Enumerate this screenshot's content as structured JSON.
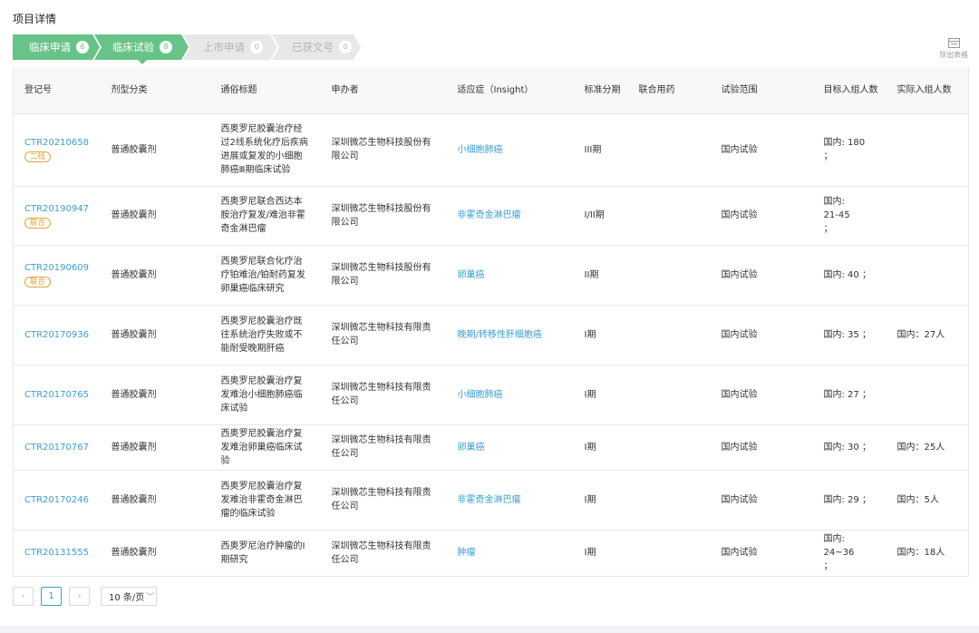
{
  "page": {
    "title": "项目详情"
  },
  "steps": [
    {
      "label": "临床申请",
      "count": "6"
    },
    {
      "label": "临床试验",
      "count": "8"
    },
    {
      "label": "上市申请",
      "count": "0"
    },
    {
      "label": "已获文号",
      "count": "0"
    }
  ],
  "toolbar": {
    "export_label": "导出表格"
  },
  "table": {
    "headers": {
      "reg_no": "登记号",
      "dosage_form": "剂型分类",
      "title": "通俗标题",
      "sponsor": "申办者",
      "indication": "适应症（Insight）",
      "phase": "标准分期",
      "combo": "联合用药",
      "scope": "试验范围",
      "target": "目标入组人数",
      "actual": "实际入组人数"
    },
    "rows": [
      {
        "reg_no": "CTR20210658",
        "tag": "二线",
        "dosage_form": "普通胶囊剂",
        "title": "西奥罗尼胶囊治疗经过2线系统化疗后疾病进展或复发的小细胞肺癌Ⅲ期临床试验",
        "sponsor": "深圳微芯生物科技股份有限公司",
        "indication": "小细胞肺癌",
        "phase": "III期",
        "combo": "",
        "scope": "国内试验",
        "target": "国内: 180 ；",
        "actual": ""
      },
      {
        "reg_no": "CTR20190947",
        "tag": "联合",
        "dosage_form": "普通胶囊剂",
        "title": "西奥罗尼联合西达本胺治疗复发/难治非霍奇金淋巴瘤",
        "sponsor": "深圳微芯生物科技股份有限公司",
        "indication": "非霍奇金淋巴瘤",
        "phase": "I/II期",
        "combo": "",
        "scope": "国内试验",
        "target": "国内: 21-45 ；",
        "actual": ""
      },
      {
        "reg_no": "CTR20190609",
        "tag": "联合",
        "dosage_form": "普通胶囊剂",
        "title": "西奥罗尼联合化疗治疗铂难治/铂耐药复发卵巢癌临床研究",
        "sponsor": "深圳微芯生物科技股份有限公司",
        "indication": "卵巢癌",
        "phase": "II期",
        "combo": "",
        "scope": "国内试验",
        "target": "国内: 40 ；",
        "actual": ""
      },
      {
        "reg_no": "CTR20170936",
        "tag": "",
        "dosage_form": "普通胶囊剂",
        "title": "西奥罗尼胶囊治疗既往系统治疗失败或不能耐受晚期肝癌",
        "sponsor": "深圳微芯生物科技有限责任公司",
        "indication": "晚期/转移性肝细胞癌",
        "phase": "I期",
        "combo": "",
        "scope": "国内试验",
        "target": "国内: 35 ；",
        "actual": "国内：27人"
      },
      {
        "reg_no": "CTR20170765",
        "tag": "",
        "dosage_form": "普通胶囊剂",
        "title": "西奥罗尼胶囊治疗复发难治小细胞肺癌临床试验",
        "sponsor": "深圳微芯生物科技有限责任公司",
        "indication": "小细胞肺癌",
        "phase": "I期",
        "combo": "",
        "scope": "国内试验",
        "target": "国内: 27 ；",
        "actual": ""
      },
      {
        "reg_no": "CTR20170767",
        "tag": "",
        "dosage_form": "普通胶囊剂",
        "title": "西奥罗尼胶囊治疗复发难治卵巢癌临床试验",
        "sponsor": "深圳微芯生物科技有限责任公司",
        "indication": "卵巢癌",
        "phase": "I期",
        "combo": "",
        "scope": "国内试验",
        "target": "国内: 30 ；",
        "actual": "国内：25人"
      },
      {
        "reg_no": "CTR20170246",
        "tag": "",
        "dosage_form": "普通胶囊剂",
        "title": "西奥罗尼胶囊治疗复发难治非霍奇金淋巴瘤的临床试验",
        "sponsor": "深圳微芯生物科技有限责任公司",
        "indication": "非霍奇金淋巴瘤",
        "phase": "I期",
        "combo": "",
        "scope": "国内试验",
        "target": "国内: 29 ；",
        "actual": "国内：5人"
      },
      {
        "reg_no": "CTR20131555",
        "tag": "",
        "dosage_form": "普通胶囊剂",
        "title": "西奥罗尼治疗肿瘤的I期研究",
        "sponsor": "深圳微芯生物科技有限责任公司",
        "indication": "肿瘤",
        "phase": "I期",
        "combo": "",
        "scope": "国内试验",
        "target": "国内: 24~36 ；",
        "actual": "国内：18人"
      }
    ]
  },
  "pagination": {
    "prev": "‹",
    "current_page": "1",
    "next": "›",
    "page_size": "10 条/页"
  }
}
